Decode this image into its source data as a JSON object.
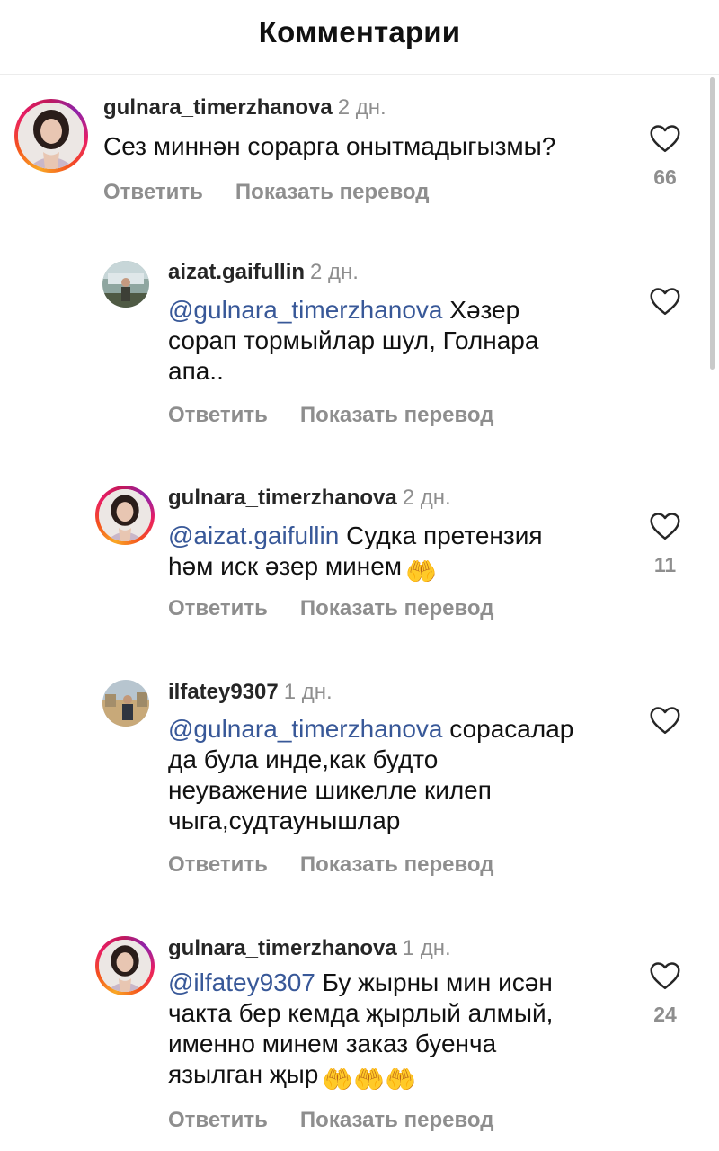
{
  "header": {
    "title": "Комментарии"
  },
  "actions": {
    "reply": "Ответить",
    "translate": "Показать перевод"
  },
  "comments": [
    {
      "username": "gulnara_timerzhanova",
      "time": "2 дн.",
      "mention": "",
      "text": "Сез миннән сорарга онытмадыгызмы?",
      "likes": "66",
      "avatar": "woman-portrait",
      "story_ring": true
    },
    {
      "username": "aizat.gaifullin",
      "time": "2 дн.",
      "mention": "@gulnara_timerzhanova",
      "text": "  Хәзер\nсорап тормыйлар шул, Голнара\nапа..",
      "likes": "",
      "avatar": "man-outdoor",
      "story_ring": false
    },
    {
      "username": "gulnara_timerzhanova",
      "time": "2 дн.",
      "mention": "@aizat.gaifullin",
      "text": " Судка претензия\nһәм иск әзер минем",
      "likes": "11",
      "avatar": "woman-portrait",
      "story_ring": true,
      "emoji": "🤲"
    },
    {
      "username": "ilfatey9307",
      "time": "1 дн.",
      "mention": "@gulnara_timerzhanova",
      "text": " сорасалар\nда була инде,как будто\nнеуважение шикелле килеп\nчыга,судтаунышлар",
      "likes": "",
      "avatar": "man-landscape",
      "story_ring": false
    },
    {
      "username": "gulnara_timerzhanova",
      "time": "1 дн.",
      "mention": "@ilfatey9307",
      "text": " Бу жырны мин исән\nчакта бер кемда җырлый алмый,\nименно минем заказ буенча\nязылган җыр",
      "likes": "24",
      "avatar": "woman-portrait",
      "story_ring": true,
      "emoji": "🤲🤲🤲"
    }
  ],
  "icons": {
    "like": "heart-outline-icon"
  }
}
